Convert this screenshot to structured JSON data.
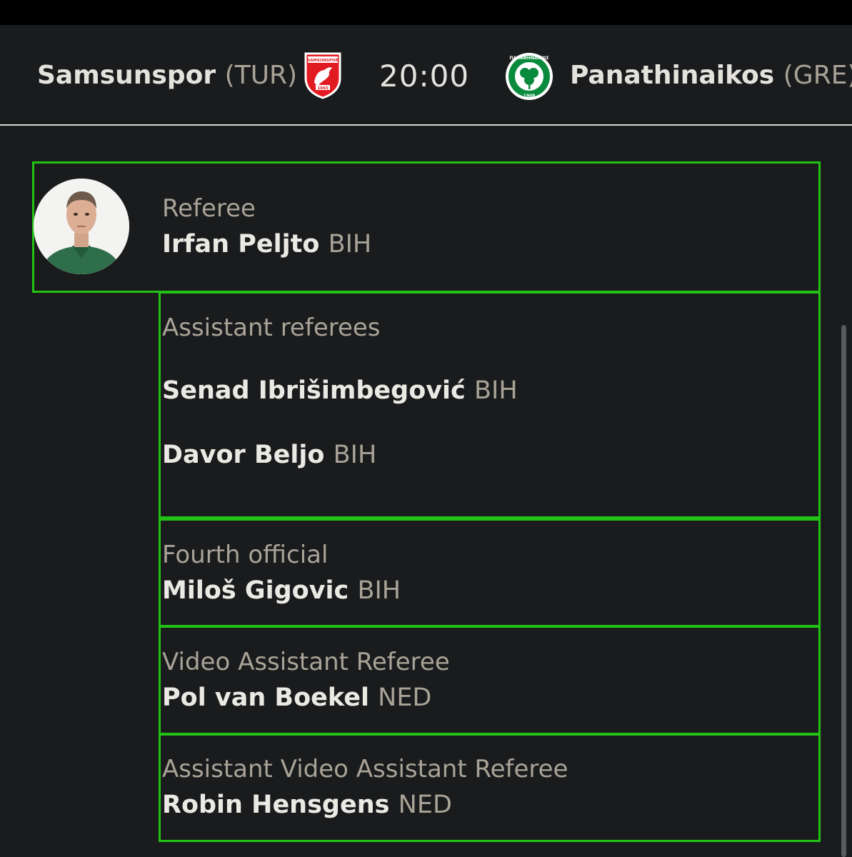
{
  "match": {
    "home_team": "Samsunspor",
    "home_country": "(TUR)",
    "kickoff": "20:00",
    "away_team": "Panathinaikos",
    "away_country": "(GRE)",
    "home_crest_text": "SAMSUNSPOR",
    "home_crest_year": "1965",
    "away_crest_text": "ΠΑΝΑΘΗΝΑΪΚΟΣ",
    "away_crest_year": "1908"
  },
  "officials": {
    "referee": {
      "role": "Referee",
      "name": "Irfan Peljto",
      "nat": "BIH"
    },
    "assistants": {
      "role": "Assistant referees",
      "people": [
        {
          "name": "Senad Ibrišimbegović",
          "nat": "BIH"
        },
        {
          "name": "Davor Beljo",
          "nat": "BIH"
        }
      ]
    },
    "fourth": {
      "role": "Fourth official",
      "name": "Miloš Gigovic",
      "nat": "BIH"
    },
    "var": {
      "role": "Video Assistant Referee",
      "name": "Pol van Boekel",
      "nat": "NED"
    },
    "avar": {
      "role": "Assistant Video Assistant Referee",
      "name": "Robin Hensgens",
      "nat": "NED"
    }
  },
  "colors": {
    "background": "#1a1b1d",
    "highlight_border": "#22c214",
    "label": "#a9a397",
    "text": "#ebe9e3"
  }
}
